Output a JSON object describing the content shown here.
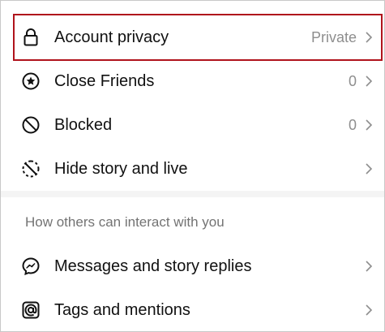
{
  "settings": {
    "items": [
      {
        "label": "Account privacy",
        "value": "Private",
        "icon": "lock-icon"
      },
      {
        "label": "Close Friends",
        "value": "0",
        "icon": "star-circle-icon"
      },
      {
        "label": "Blocked",
        "value": "0",
        "icon": "blocked-icon"
      },
      {
        "label": "Hide story and live",
        "value": "",
        "icon": "hide-story-icon"
      }
    ],
    "section_title": "How others can interact with you",
    "interaction_items": [
      {
        "label": "Messages and story replies",
        "icon": "messenger-icon"
      },
      {
        "label": "Tags and mentions",
        "icon": "at-mention-icon"
      }
    ]
  },
  "colors": {
    "highlight_border": "#b0131c",
    "secondary_text": "#8e8e8e",
    "section_title": "#737373"
  }
}
